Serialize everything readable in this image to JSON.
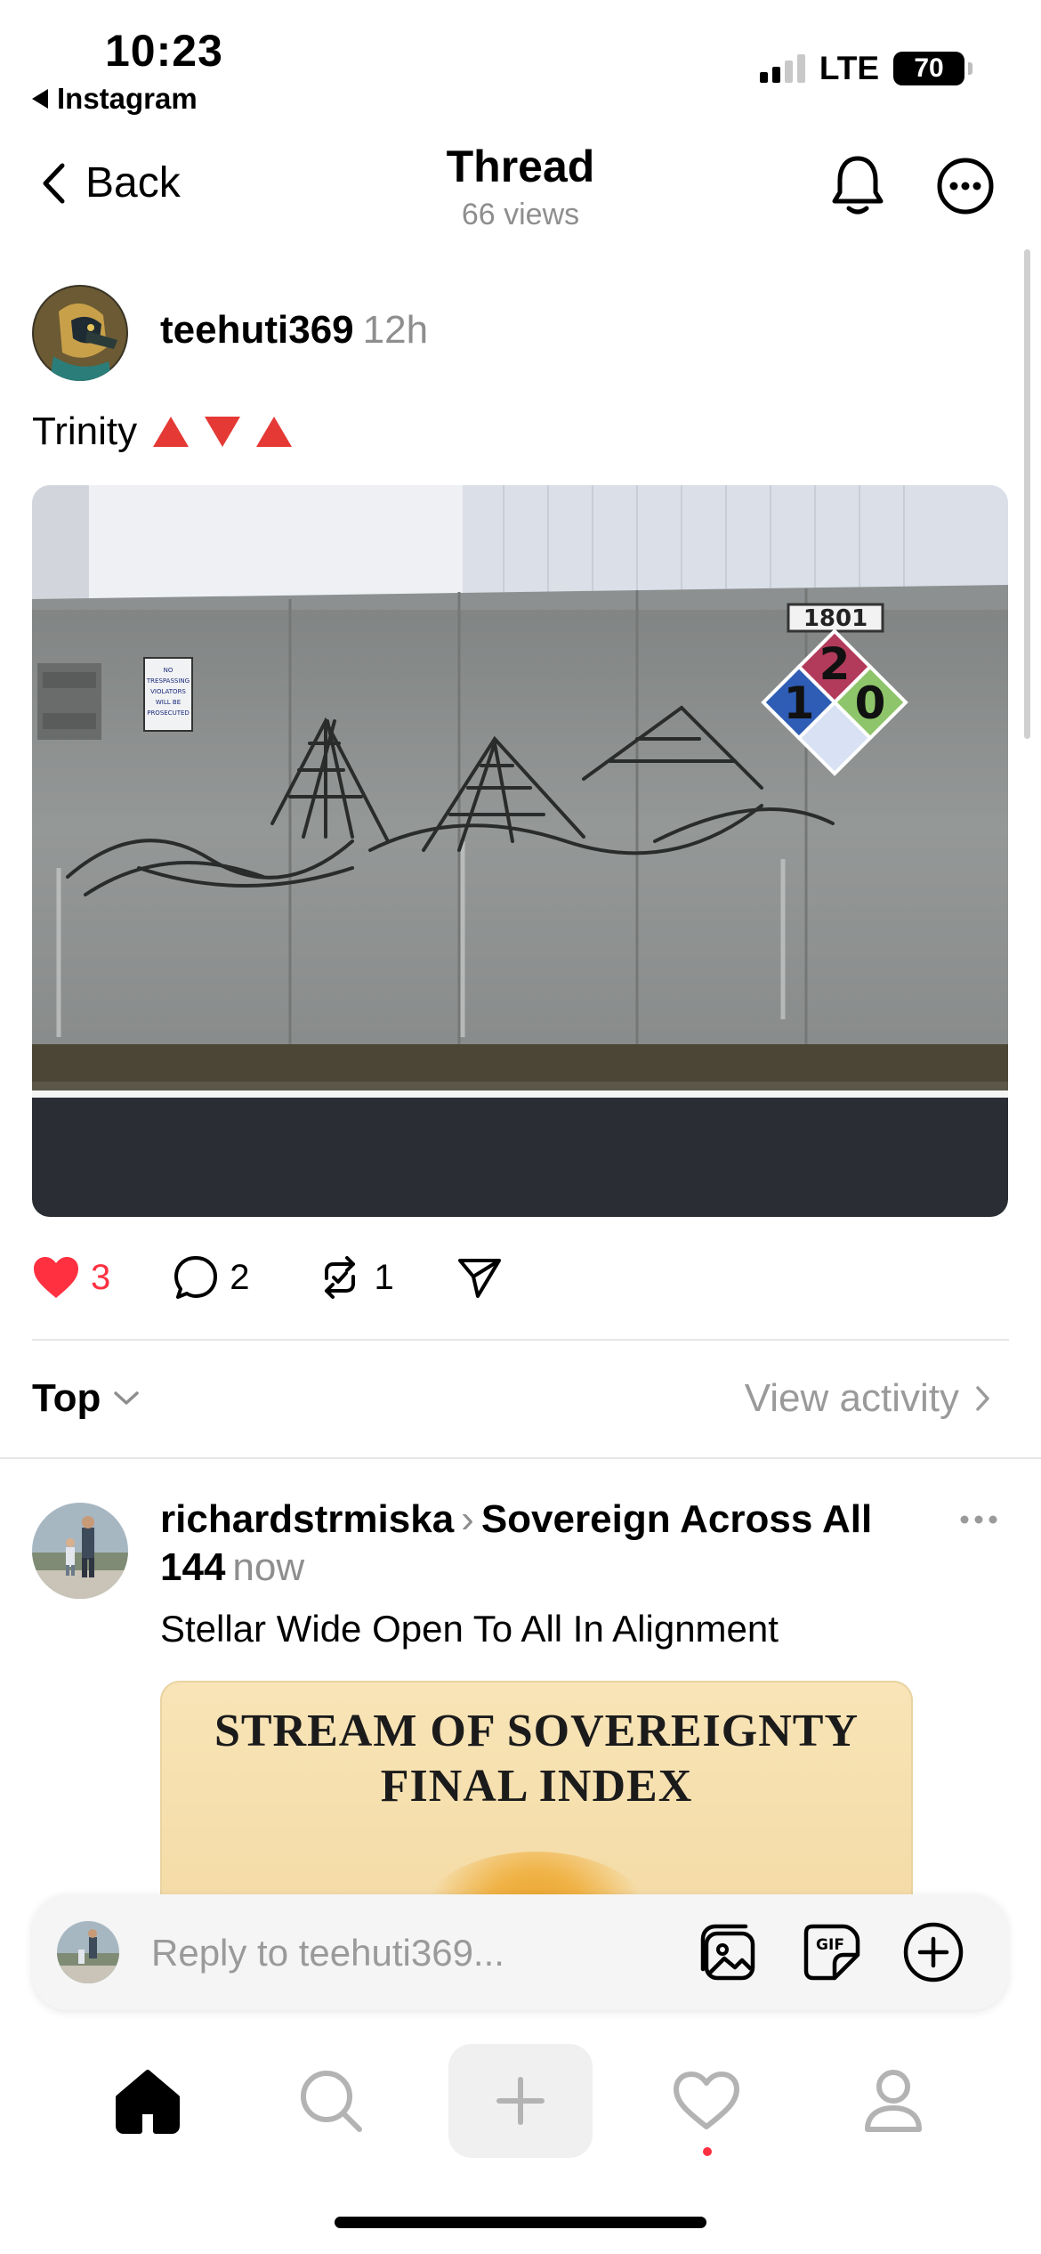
{
  "status": {
    "time": "10:23",
    "back_app": "Instagram",
    "network": "LTE",
    "battery": "70"
  },
  "header": {
    "back_label": "Back",
    "title": "Thread",
    "subtitle": "66 views"
  },
  "post": {
    "username": "teehuti369",
    "time": "12h",
    "text": "Trinity",
    "emoji_icons": [
      "red-triangle-up-icon",
      "red-triangle-down-icon",
      "red-triangle-up-icon"
    ],
    "image": {
      "building_number": "1801",
      "sign_text": [
        "NO",
        "TRESPASSING",
        "VIOLATORS",
        "WILL BE",
        "PROSECUTED"
      ],
      "hazard_top": "2",
      "hazard_left": "1",
      "hazard_right": "0"
    },
    "likes": "3",
    "replies": "2",
    "reposts": "1",
    "like_color": "#ff3040"
  },
  "sort": {
    "label": "Top",
    "view_activity": "View activity"
  },
  "reply": {
    "username": "richardstrmiska",
    "community": "Sovereign Across All 144",
    "time": "now",
    "text": "Stellar Wide Open To All In Alignment",
    "card_title_line1": "STREAM OF SOVEREIGNTY",
    "card_title_line2": "FINAL INDEX"
  },
  "composer": {
    "placeholder": "Reply to teehuti369...",
    "gif_label": "GIF"
  },
  "tabbar": {
    "items": [
      "home-icon",
      "search-icon",
      "create-icon",
      "activity-icon",
      "profile-icon"
    ]
  }
}
